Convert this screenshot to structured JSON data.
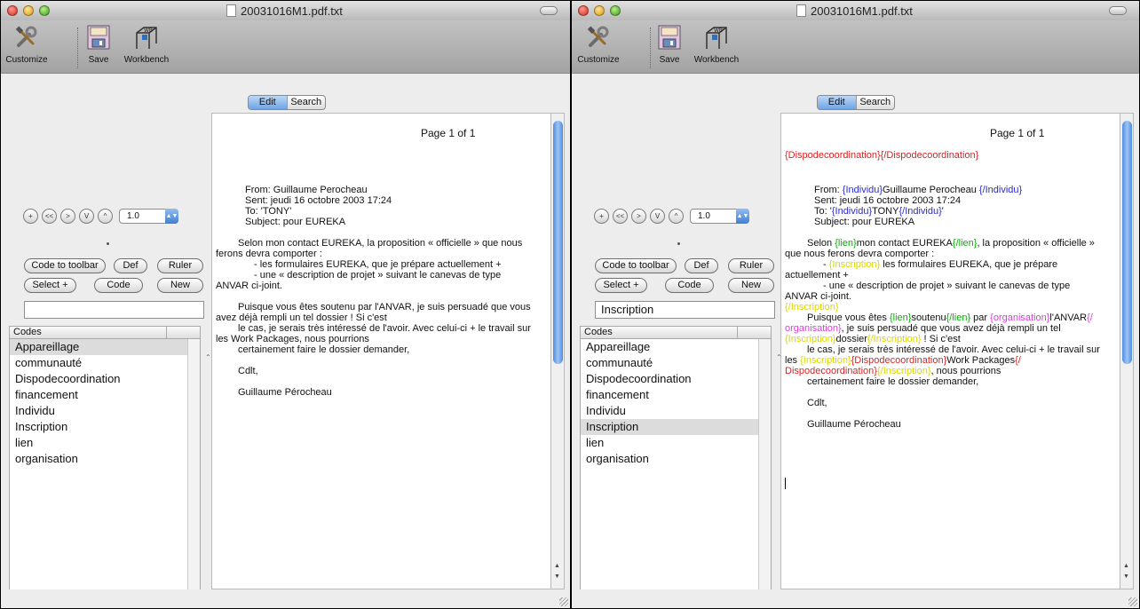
{
  "colors": {
    "tag_lien": "#00b400",
    "tag_individu": "#2a2ad0",
    "tag_organisation": "#e03ce0",
    "tag_inscription": "#d8d800",
    "tag_dispodecoordination": "#e02020"
  },
  "windows": [
    {
      "title": "20031016M1.pdf.txt",
      "toolbar": {
        "customize": "Customize",
        "save": "Save",
        "workbench": "Workbench"
      },
      "tabs": {
        "edit": "Edit",
        "search": "Search"
      },
      "zoom_value": "1.0",
      "buttons": {
        "code_to_toolbar": "Code to toolbar",
        "def": "Def",
        "ruler": "Ruler",
        "select": "Select +",
        "code": "Code",
        "new": "New"
      },
      "code_field_value": "",
      "codes_header": "Codes",
      "selected_code_index": -1,
      "codes": [
        "Appareillage",
        "communauté",
        "Dispodecoordination",
        "financement",
        "Individu",
        "Inscription",
        "lien",
        "organisation"
      ],
      "document": {
        "page": "Page 1 of 1",
        "l01": "From: Guillaume Perocheau",
        "l02": "Sent: jeudi 16 octobre 2003 17:24",
        "l03": "To: 'TONY'",
        "l04": "Subject: pour EUREKA",
        "l05": "Selon mon contact EUREKA, la proposition « officielle » que nous",
        "l06": "ferons devra comporter :",
        "l07": "- les formulaires EUREKA, que je prépare actuellement +",
        "l08": "- une « description de projet » suivant le canevas de type",
        "l09": "ANVAR ci-joint.",
        "l10": "Puisque vous êtes soutenu par l'ANVAR, je suis persuadé que vous",
        "l11": "avez déjà rempli un tel dossier ! Si c'est",
        "l12": "le cas, je serais très intéressé de l'avoir. Avec celui-ci + le travail sur",
        "l13": "les Work Packages, nous pourrions",
        "l14": "certainement faire le dossier demander,",
        "l15": "Cdlt,",
        "l16": "Guillaume Pérocheau"
      }
    },
    {
      "title": "20031016M1.pdf.txt",
      "toolbar": {
        "customize": "Customize",
        "save": "Save",
        "workbench": "Workbench"
      },
      "tabs": {
        "edit": "Edit",
        "search": "Search"
      },
      "zoom_value": "1.0",
      "buttons": {
        "code_to_toolbar": "Code to toolbar",
        "def": "Def",
        "ruler": "Ruler",
        "select": "Select +",
        "code": "Code",
        "new": "New"
      },
      "code_field_value": "Inscription",
      "codes_header": "Codes",
      "selected_code_index": 5,
      "codes": [
        "Appareillage",
        "communauté",
        "Dispodecoordination",
        "financement",
        "Individu",
        "Inscription",
        "lien",
        "organisation"
      ],
      "document": {
        "page": "Page 1 of 1",
        "t_dispo_open": "{Dispodecoordination}",
        "t_dispo_close": "{/Dispodecoordination}",
        "l01_a": "From: ",
        "l01_t1": "{Individu}",
        "l01_b": "Guillaume Perocheau ",
        "l01_t2": "{/Individu}",
        "l02": "Sent: jeudi 16 octobre 2003 17:24",
        "l03_a": "To: '",
        "l03_t1": "{Individu}",
        "l03_b": "TONY",
        "l03_t2": "{/Individu}",
        "l03_c": "'",
        "l04": "Subject: pour EUREKA",
        "l05_a": "Selon ",
        "l05_t1": "{lien}",
        "l05_b": "mon contact EUREKA",
        "l05_t2": "{/lien}",
        "l05_c": ", la proposition « officielle »",
        "l06": "que nous ferons devra comporter :",
        "l07_a": "- ",
        "l07_t1": "{Inscription}",
        "l07_b": "  les formulaires EUREKA, que je prépare",
        "l08": "actuellement +",
        "l09": "- une « description de projet » suivant le canevas de type",
        "l10": "ANVAR ci-joint.",
        "l11_t": "{/Inscription}",
        "l12_a": "Puisque vous êtes ",
        "l12_t1": "{lien}",
        "l12_b": "soutenu",
        "l12_t2": "{/lien}",
        "l12_c": " par ",
        "l12_t3": "{organisation}",
        "l12_d": "l'ANVAR",
        "l12_t4": "{/",
        "l13_t1": "organisation}",
        "l13_a": ", je suis persuadé que vous avez déjà rempli un tel",
        "l14_t1": "{Inscription}",
        "l14_a": "dossier",
        "l14_t2": "{/Inscription}",
        "l14_b": " ! Si c'est",
        "l15": "le cas, je serais très intéressé de l'avoir. Avec celui-ci + le travail sur",
        "l16_a": "les ",
        "l16_t1": "{Inscription}",
        "l16_t2": "{Dispodecoordination}",
        "l16_b": "Work Packages",
        "l16_t3": "{/",
        "l17_t1": "Dispodecoordination}",
        "l17_t2": "{/Inscription}",
        "l17_a": ", nous pourrions",
        "l18": "certainement faire le dossier demander,",
        "l19": "Cdlt,",
        "l20": "Guillaume Pérocheau"
      }
    }
  ]
}
